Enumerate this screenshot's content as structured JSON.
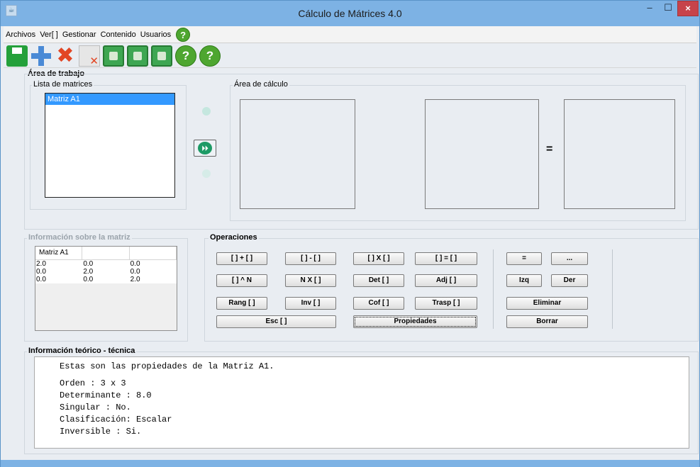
{
  "window": {
    "title": "Cálculo de Mátrices 4.0",
    "icon_name": "java-app-icon",
    "controls": [
      "minimize",
      "maximize",
      "close"
    ]
  },
  "menu": {
    "items": [
      "Archivos",
      "Ver[ ]",
      "Gestionar",
      "Contenido",
      "Usuarios"
    ],
    "help_icon": "?"
  },
  "toolbar": {
    "icons": [
      "save-icon",
      "add-icon",
      "delete-icon",
      "delete-doc-icon",
      "clipboard-icon",
      "paste-icon",
      "copy-icon",
      "help-icon",
      "about-icon"
    ],
    "round_glyphs": [
      "?",
      "?"
    ]
  },
  "work_area": {
    "title": "Área de trabajo",
    "list_title": "Lista de matrices",
    "matrices": [
      "Matriz A1"
    ],
    "calc_title": "Área de cálculo",
    "equals_sign": "=",
    "move_glyph": "⏵⏵"
  },
  "matrix_info": {
    "title": "Información sobre la matriz",
    "header": [
      "Matriz A1",
      "",
      ""
    ],
    "rows": [
      [
        "2.0",
        "0.0",
        "0.0"
      ],
      [
        "0.0",
        "2.0",
        "0.0"
      ],
      [
        "0.0",
        "0.0",
        "2.0"
      ]
    ]
  },
  "operations": {
    "title": "Operaciones",
    "buttons": {
      "sum": "[ ] + [ ]",
      "sub": "[ ] - [ ]",
      "mul": "[ ] X [ ]",
      "eq": "[ ] = [ ]",
      "pow": "[ ] ^ N",
      "scalar": "N X [ ]",
      "det": "Det [ ]",
      "adj": "Adj [ ]",
      "rank": "Rang [ ]",
      "inv": "Inv [ ]",
      "cof": "Cof [ ]",
      "transp": "Trasp [ ]",
      "esc": "Esc [ ]",
      "props": "Propiedades",
      "equals": "=",
      "dots": "...",
      "left": "Izq",
      "right": "Der",
      "remove": "Eliminar",
      "clear": "Borrar"
    }
  },
  "theory": {
    "title": "Información teórico - técnica",
    "lines": [
      "Estas son las propiedades de la Matriz A1.",
      "",
      "Orden : 3 x 3",
      "Determinante : 8.0",
      "Singular : No.",
      "Clasificación: Escalar",
      "Inversible : Si."
    ]
  },
  "colors": {
    "titlebar": "#7db2e4",
    "selection": "#3399ff",
    "close": "#c7434a",
    "icon_green": "#4ea630"
  }
}
